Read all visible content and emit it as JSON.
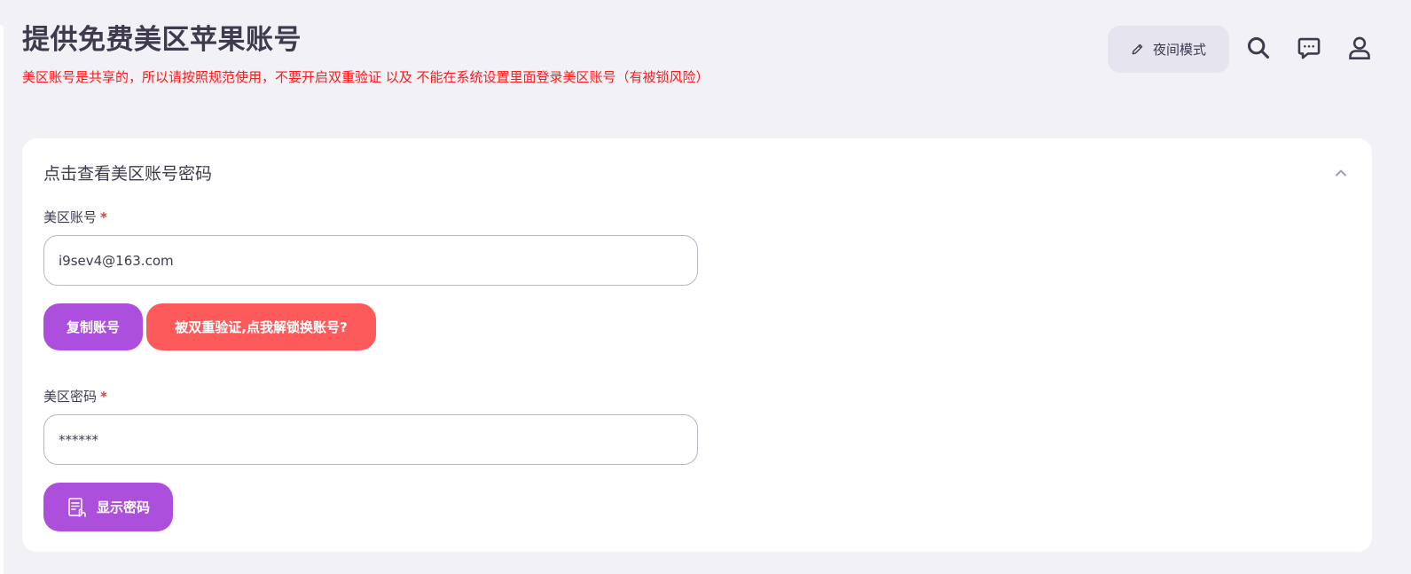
{
  "header": {
    "title": "提供免费美区苹果账号",
    "notice": "美区账号是共享的，所以请按照规范使用，不要开启双重验证 以及 不能在系统设置里面登录美区账号（有被锁风险）",
    "night_mode_label": "夜间模式",
    "icons": [
      "search-icon",
      "chat-icon",
      "user-icon"
    ]
  },
  "card": {
    "title": "点击查看美区账号密码",
    "account": {
      "label": "美区账号",
      "required_mark": "*",
      "value": "i9sev4@163.com"
    },
    "copy_button": "复制账号",
    "unlock_button": "被双重验证,点我解锁换账号?",
    "password": {
      "label": "美区密码",
      "required_mark": "*",
      "value": "******"
    },
    "show_password_button": "显示密码"
  },
  "colors": {
    "accent_purple": "#ad4fdd",
    "accent_red": "#fd5b5b",
    "notice_red": "#ff1a1a",
    "background": "#f1f1f6"
  }
}
